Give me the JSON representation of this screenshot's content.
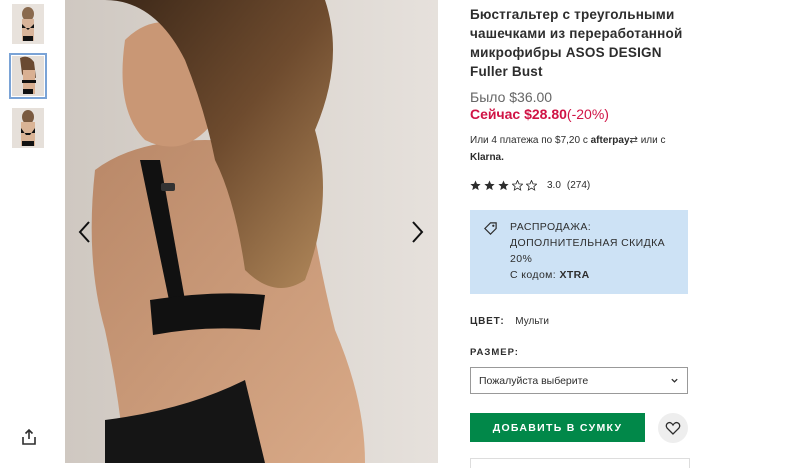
{
  "gallery": {
    "thumbnails": [
      {
        "name": "thumbnail-1",
        "active": false
      },
      {
        "name": "thumbnail-2",
        "active": true
      },
      {
        "name": "thumbnail-3",
        "active": false
      }
    ],
    "share_icon": "share-icon",
    "prev_icon": "chevron-left-icon",
    "next_icon": "chevron-right-icon"
  },
  "product": {
    "title": "Бюстгальтер с треугольными чашечками из переработанной микрофибры ASOS DESIGN Fuller Bust",
    "price_was": "Было $36.00",
    "price_now_label": "Сейчас $28.80",
    "price_discount": "(-20%)",
    "payment": {
      "prefix": "Или 4 платежа по $7,20 с",
      "afterpay": "afterpay",
      "middle": "или с",
      "klarna": "Klarna."
    },
    "rating": {
      "stars": 3,
      "max": 5,
      "score": "3.0",
      "count": "(274)"
    }
  },
  "promo": {
    "line1": "РАСПРОДАЖА:",
    "line2": "ДОПОЛНИТЕЛЬНАЯ СКИДКА",
    "line3": "20%",
    "code_label": "С кодом:",
    "code": "XTRA",
    "icon": "price-tag-icon"
  },
  "options": {
    "color_label": "ЦВЕТ:",
    "color_value": "Мульти",
    "size_label": "РАЗМЕР:",
    "size_placeholder": "Пожалуйста выберите"
  },
  "actions": {
    "add_to_bag": "ДОБАВИТЬ В СУМКУ",
    "save_icon": "heart-icon"
  },
  "colors": {
    "sale_red": "#d01345",
    "button_green": "#018849",
    "promo_blue": "#cde2f5"
  }
}
